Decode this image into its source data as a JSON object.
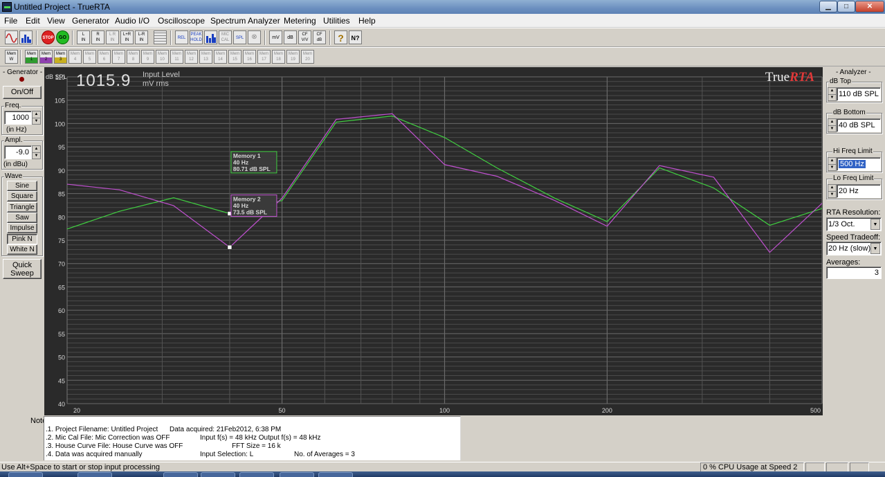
{
  "window": {
    "title": "Untitled Project - TrueRTA",
    "minimize_glyph": "▁",
    "maximize_glyph": "□",
    "close_glyph": "✕"
  },
  "menu": [
    "File",
    "Edit",
    "View",
    "Generator",
    "Audio I/O",
    "Oscilloscope",
    "Spectrum Analyzer",
    "Metering",
    "Utilities",
    "Help"
  ],
  "toolbar1": {
    "stop": "STOP",
    "go": "GO",
    "in_left": "L\nIN",
    "in_right": "R\nIN",
    "in_lr": "L R\nIN",
    "in_lplusr": "L+R\nIN",
    "in_lminusr": "L-R\nIN",
    "rel": "REL",
    "peak_hold": "PEAK\nHOLD",
    "mic_cal": "MIC\nCAL",
    "spl": "SPL",
    "mv": "mV",
    "db": "dB",
    "cf_vv": "CF\nV/V",
    "cf_db": "CF\ndB",
    "help": "?",
    "context_help": "N?"
  },
  "toolbar2": {
    "mem_w": "Mem\nW",
    "mem_labels": [
      "Mem\n1",
      "Mem\n2",
      "Mem\n3",
      "Mem\n4",
      "Mem\n5",
      "Mem\n6",
      "Mem\n7",
      "Mem\n8",
      "Mem\n9",
      "Mem\n10",
      "Mem\n11",
      "Mem\n12",
      "Mem\n13",
      "Mem\n14",
      "Mem\n15",
      "Mem\n16",
      "Mem\n17",
      "Mem\n18",
      "Mem\n19",
      "Mem\n20"
    ]
  },
  "generator": {
    "header": "- Generator -",
    "onoff": "On/Off",
    "freq_label": "Freq.",
    "freq_value": "1000",
    "freq_unit": "(in Hz)",
    "ampl_label": "Ampl.",
    "ampl_value": "-9.0",
    "ampl_unit": "(in dBu)",
    "wave_label": "Wave",
    "waves": [
      "Sine",
      "Square",
      "Triangle",
      "Saw",
      "Impulse",
      "Pink N",
      "White N"
    ],
    "selected_wave": "Pink N",
    "quick_sweep": "Quick\nSweep"
  },
  "analyzer": {
    "header": "- Analyzer -",
    "db_top_label": "dB Top",
    "db_top_value": "110 dB SPL",
    "db_bottom_label": "dB Bottom",
    "db_bottom_value": "40 dB SPL",
    "hi_freq_label": "Hi Freq Limit",
    "hi_freq_value": "500 Hz",
    "lo_freq_label": "Lo Freq Limit",
    "lo_freq_value": "20 Hz",
    "resolution_label": "RTA Resolution:",
    "resolution_value": "1/3 Oct.",
    "speed_label": "Speed Tradeoff:",
    "speed_value": "20 Hz (slow)",
    "averages_label": "Averages:",
    "averages_value": "3",
    "spin_glyph_up": "▲",
    "spin_glyph_down": "▼",
    "combo_glyph": "▼"
  },
  "plot": {
    "readout_value": "1015.9",
    "readout_caption1": "Input Level",
    "readout_caption2": "mV rms",
    "y_unit": "dB SPL",
    "brand_a": "True",
    "brand_b": "RTA",
    "colors": {
      "background": "#2a2a2a",
      "grid": "#5a5a5a",
      "memory1": "#40d040",
      "memory2": "#c050d0",
      "axis_text": "#d8d8d8"
    }
  },
  "chart_data": {
    "type": "line",
    "xscale": "log",
    "xlim": [
      20,
      500
    ],
    "ylim": [
      40,
      110
    ],
    "x_ticks": [
      20,
      50,
      100,
      200,
      500
    ],
    "y_ticks": [
      110,
      105,
      100,
      95,
      90,
      85,
      80,
      75,
      70,
      65,
      60,
      55,
      50,
      45,
      40
    ],
    "x": [
      20,
      25,
      31.5,
      40,
      50,
      63,
      80,
      100,
      125,
      160,
      200,
      250,
      315,
      400,
      500
    ],
    "series": [
      {
        "name": "Memory 1",
        "color": "#40d040",
        "values": [
          77.4,
          81.2,
          84.1,
          80.71,
          83.5,
          100.3,
          101.6,
          97.0,
          90.5,
          84.0,
          79.0,
          90.5,
          86.2,
          78.2,
          81.8
        ]
      },
      {
        "name": "Memory 2",
        "color": "#c050d0",
        "values": [
          87.0,
          85.8,
          82.4,
          73.5,
          84.0,
          100.9,
          102.1,
          91.2,
          88.7,
          83.5,
          78.0,
          91.0,
          88.5,
          72.4,
          82.9
        ]
      }
    ],
    "annotations": [
      {
        "title": "Memory 1",
        "freq": "40 Hz",
        "level": "80.71 dB SPL",
        "x": 40,
        "y": 80.71
      },
      {
        "title": "Memory 2",
        "freq": "40 Hz",
        "level": "73.5 dB SPL",
        "x": 40,
        "y": 73.5
      }
    ],
    "grid": true
  },
  "notes": {
    "label": "Notes:",
    "lines": [
      ".1. Project Filename: Untitled Project",
      ".2. Mic Cal File: Mic Correction was OFF",
      ".3. House Curve File: House Curve was OFF",
      ".4. Data was acquired manually"
    ],
    "col2": [
      "Data acquired: 21Feb2012, 6:38 PM",
      "Input f(s) = 48 kHz   Output f(s) = 48 kHz",
      "FFT Size = 16 k",
      "Input Selection: L"
    ],
    "averages_note": "No. of Averages = 3"
  },
  "status": {
    "hint": "Use Alt+Space to start or stop input processing",
    "cpu": "0 % CPU Usage at Speed 2"
  }
}
